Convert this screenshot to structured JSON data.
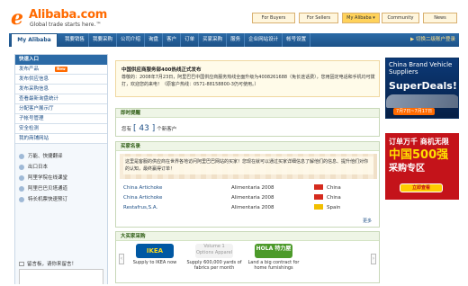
{
  "header": {
    "logo_brand": "Alibaba.com",
    "logo_tagline": "Global trade starts here.™",
    "nav": [
      "For Buyers",
      "For Sellers",
      "My Alibaba ▾",
      "Community",
      "News"
    ]
  },
  "navbar": {
    "home": "My Alibaba",
    "items": [
      "我要销售",
      "我要采购",
      "公司介绍",
      "询盘",
      "客户",
      "订单",
      "买家采购",
      "服务",
      "企业网站设计",
      "帐号设置"
    ],
    "alt_link": "▶ 切换二级账户登录"
  },
  "sidebar": {
    "title": "快速入口",
    "menu": [
      {
        "label": "发布产品",
        "badge": "New"
      },
      {
        "label": "发布供应信息",
        "badge": ""
      },
      {
        "label": "发布采购信息",
        "badge": ""
      },
      {
        "label": "查看最新询盘统计",
        "badge": ""
      },
      {
        "label": "分配客户展示厅",
        "badge": ""
      },
      {
        "label": "子帐号管理",
        "badge": ""
      },
      {
        "label": "安全检测",
        "badge": ""
      },
      {
        "label": "我的商铺网站",
        "badge": ""
      }
    ],
    "tools": [
      "万能、快捷翻译",
      "出口日本",
      "阿里学院在线课堂",
      "阿里巴巴贝塔通道",
      "特长机票快速预订"
    ],
    "message_label": "留言板，请你来留言！"
  },
  "notice": {
    "title": "中国供应商服务部400热线正式发布",
    "body": "尊敬的：2008年7月23日，阿里巴巴中国供应商服务热线全面升级为4008261688（免长途话费），您用固定电话和手机均可拨打，欢迎您的来电！（原客户热线：0571-88158800-3仍可使用。）"
  },
  "visitors": {
    "title": "即时提醒",
    "prefix": "您有",
    "count": "[ 43 ]",
    "suffix": "个新客户"
  },
  "buyers": {
    "title": "买家名录",
    "intro": "这里是客服的供应商在世界各地访问阿里巴巴网站的买家！您现在就可以通过买家详细信息了解他们的信息、提升他们对你的认知，最终赢得订单！",
    "rows": [
      {
        "name": "China Artichoke",
        "event": "Alimentaria 2008",
        "country": "China",
        "flag_color": "#d52b1e"
      },
      {
        "name": "China Artichoke",
        "event": "Alimentaria 2008",
        "country": "China",
        "flag_color": "#d52b1e"
      },
      {
        "name": "Restafrus,S.A.",
        "event": "Alimentaria 2008",
        "country": "Spain",
        "flag_color": "#f1bf00"
      }
    ],
    "more": "更多"
  },
  "procurement": {
    "title": "大买家采购",
    "items": [
      {
        "logo": "IKEA",
        "caption": "Supply to IKEA now"
      },
      {
        "logo": "Volume 1 Options Apparel",
        "caption": "Supply 600,000 yards of fabrics per month"
      },
      {
        "logo": "HOLA 特力屋",
        "caption": "Land a big contract for home furnishings"
      }
    ]
  },
  "ads": {
    "ad1": {
      "line1": "China Brand Vehicle Suppliers",
      "line2": "SuperDeals!",
      "line3": "7月7日~7月17日"
    },
    "ad2": {
      "line1": "订单万千 商机无限",
      "big_num": "中国500强",
      "big_rest": "采购专区",
      "btn": "立即查看"
    }
  },
  "colors": {
    "brand": "#ff6a00",
    "nav": "#1d5288",
    "ad_red": "#c4131a"
  }
}
